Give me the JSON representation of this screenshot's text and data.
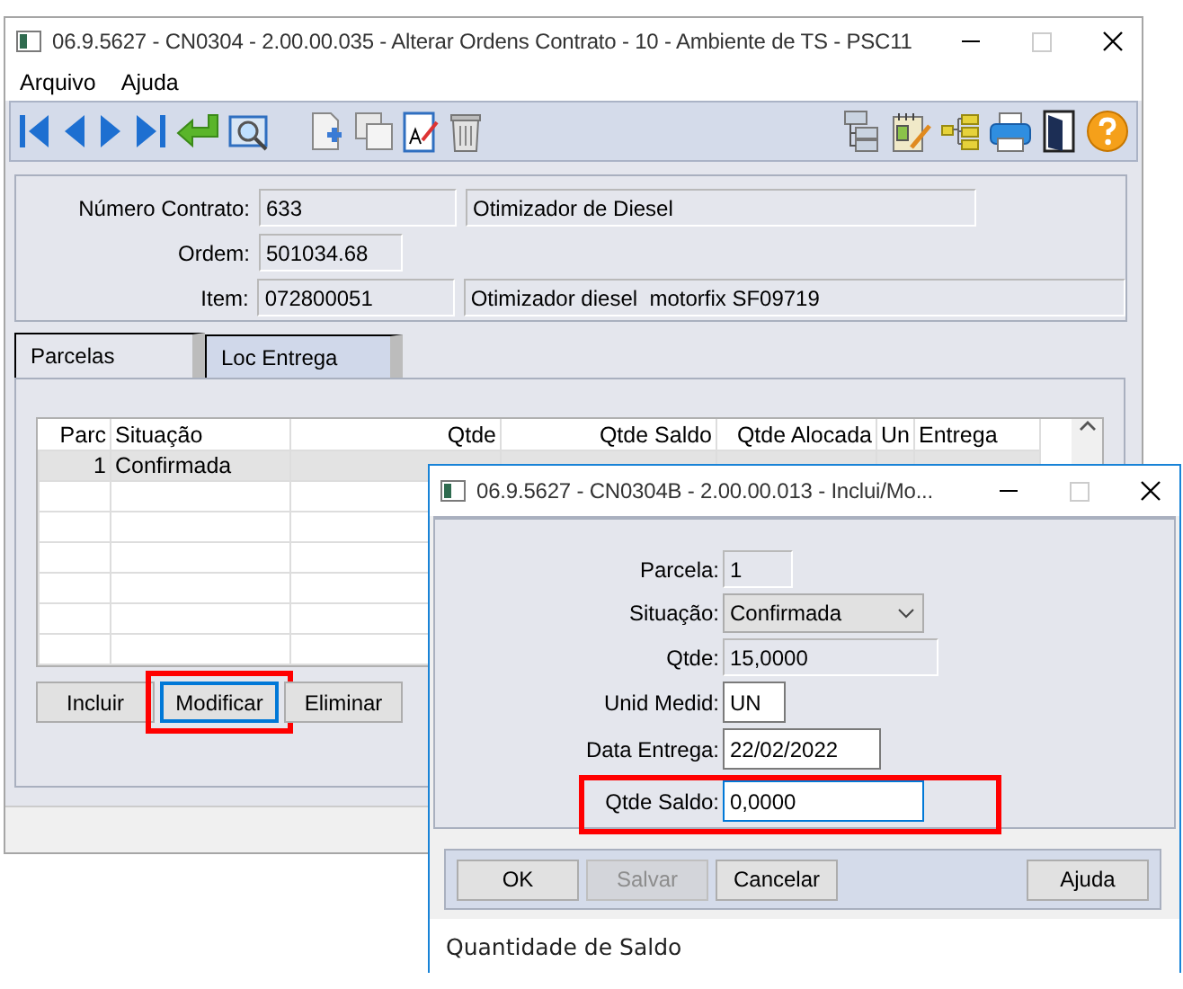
{
  "main_window": {
    "title": "06.9.5627 - CN0304 - 2.00.00.035 - Alterar Ordens Contrato - 10 - Ambiente de TS - PSC11",
    "menu": [
      "Arquivo",
      "Ajuda"
    ],
    "header_fields": [
      {
        "label": "Número Contrato:",
        "value": "633",
        "description": "Otimizador de Diesel"
      },
      {
        "label": "Ordem:",
        "value": "501034.68"
      },
      {
        "label": "Item:",
        "value": "072800051",
        "description": "Otimizador diesel  motorfix SF09719"
      }
    ],
    "tabs": [
      {
        "label": "Parcelas",
        "selected": true
      },
      {
        "label": "Loc Entrega",
        "selected": false
      }
    ],
    "grid": {
      "columns": [
        "Parc",
        "Situação",
        "Qtde",
        "Qtde Saldo",
        "Qtde Alocada",
        "Un",
        "Entrega"
      ],
      "rows": [
        {
          "cells": [
            "1",
            "Confirmada"
          ],
          "selected": true
        }
      ]
    },
    "buttons": [
      {
        "label": "Incluir",
        "focused": false,
        "highlighted": false
      },
      {
        "label": "Modificar",
        "focused": true,
        "highlighted": true
      },
      {
        "label": "Eliminar",
        "focused": false,
        "highlighted": false
      }
    ]
  },
  "dialog": {
    "title": "06.9.5627 - CN0304B - 2.00.00.013 - Inclui/Mo...",
    "fields": [
      {
        "label": "Parcela:",
        "value": "1",
        "kind": "readonly",
        "focused": false,
        "highlighted": false
      },
      {
        "label": "Situação:",
        "value": "Confirmada",
        "kind": "select",
        "focused": false,
        "highlighted": false
      },
      {
        "label": "Qtde:",
        "value": "15,0000",
        "kind": "readonly",
        "focused": false,
        "highlighted": false
      },
      {
        "label": "Unid Medid:",
        "value": "UN",
        "kind": "input",
        "focused": false,
        "highlighted": false
      },
      {
        "label": "Data Entrega:",
        "value": "22/02/2022",
        "kind": "input",
        "focused": false,
        "highlighted": false
      },
      {
        "label": "Qtde Saldo:",
        "value": "0,0000",
        "kind": "input",
        "focused": true,
        "highlighted": true
      }
    ],
    "buttons": [
      {
        "label": "OK",
        "disabled": false
      },
      {
        "label": "Salvar",
        "disabled": true
      },
      {
        "label": "Cancelar",
        "disabled": false
      },
      {
        "label": "Ajuda",
        "disabled": false
      }
    ],
    "status": "Quantidade de Saldo"
  }
}
